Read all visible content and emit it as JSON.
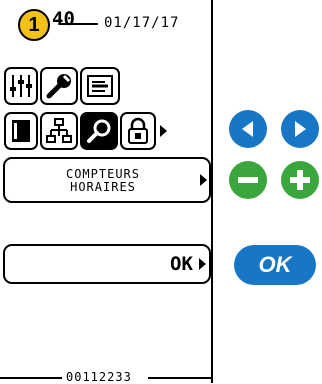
{
  "header": {
    "step_number": "1",
    "level": "40",
    "date": "01/17/17"
  },
  "menu": {
    "item_label_line1": "COMPTEURS",
    "item_label_line2": "HORAIRES",
    "ok_label": "OK"
  },
  "footer": {
    "serial": "00112233"
  },
  "controls": {
    "ok_button_label": "OK",
    "color_blue": "#1776c6",
    "color_green": "#3aa63c",
    "badge_color": "#f2c21a"
  },
  "icons": [
    "sliders-icon",
    "wrench-icon",
    "printer-icon",
    "document-icon",
    "network-icon",
    "search-icon",
    "lock-icon"
  ]
}
